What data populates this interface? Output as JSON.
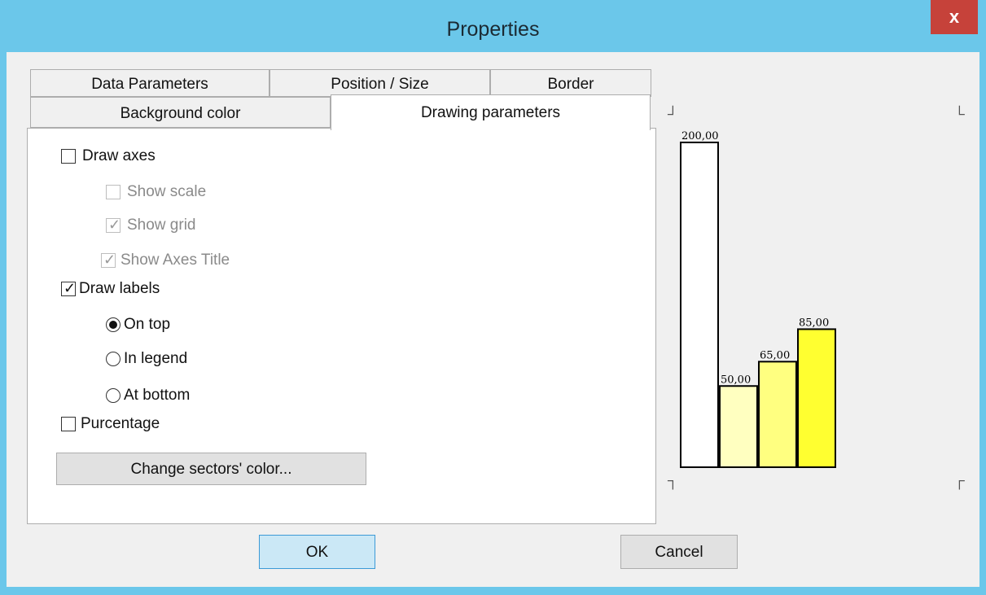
{
  "window": {
    "title": "Properties",
    "close_glyph": "x"
  },
  "tabs": {
    "row1": [
      {
        "label": "Data Parameters"
      },
      {
        "label": "Position / Size"
      },
      {
        "label": "Border"
      }
    ],
    "row2": [
      {
        "label": "Background color"
      },
      {
        "label": "Drawing parameters",
        "active": true
      }
    ]
  },
  "options": {
    "draw_axes": {
      "label": "Draw axes",
      "checked": false
    },
    "show_scale": {
      "label": "Show scale",
      "checked": false,
      "disabled": true
    },
    "show_grid": {
      "label": "Show grid",
      "checked": true,
      "disabled": true
    },
    "show_axes_title": {
      "label": "Show Axes Title",
      "checked": true,
      "disabled": true
    },
    "draw_labels": {
      "label": "Draw labels",
      "checked": true
    },
    "label_position": {
      "on_top": {
        "label": "On top",
        "selected": true
      },
      "in_legend": {
        "label": "In legend",
        "selected": false
      },
      "at_bottom": {
        "label": "At bottom",
        "selected": false
      }
    },
    "purcentage": {
      "label": "Purcentage",
      "checked": false
    }
  },
  "buttons": {
    "change_color": "Change sectors' color...",
    "ok": "OK",
    "cancel": "Cancel"
  },
  "chart_data": {
    "type": "bar",
    "categories": [
      "",
      "",
      "",
      ""
    ],
    "values": [
      200,
      50,
      65,
      85
    ],
    "value_labels": [
      "200,00",
      "50,00",
      "65,00",
      "85,00"
    ],
    "colors": [
      "#ffffff",
      "#ffffc0",
      "#ffff80",
      "#ffff30"
    ],
    "ylim": [
      0,
      200
    ],
    "grid": false
  }
}
